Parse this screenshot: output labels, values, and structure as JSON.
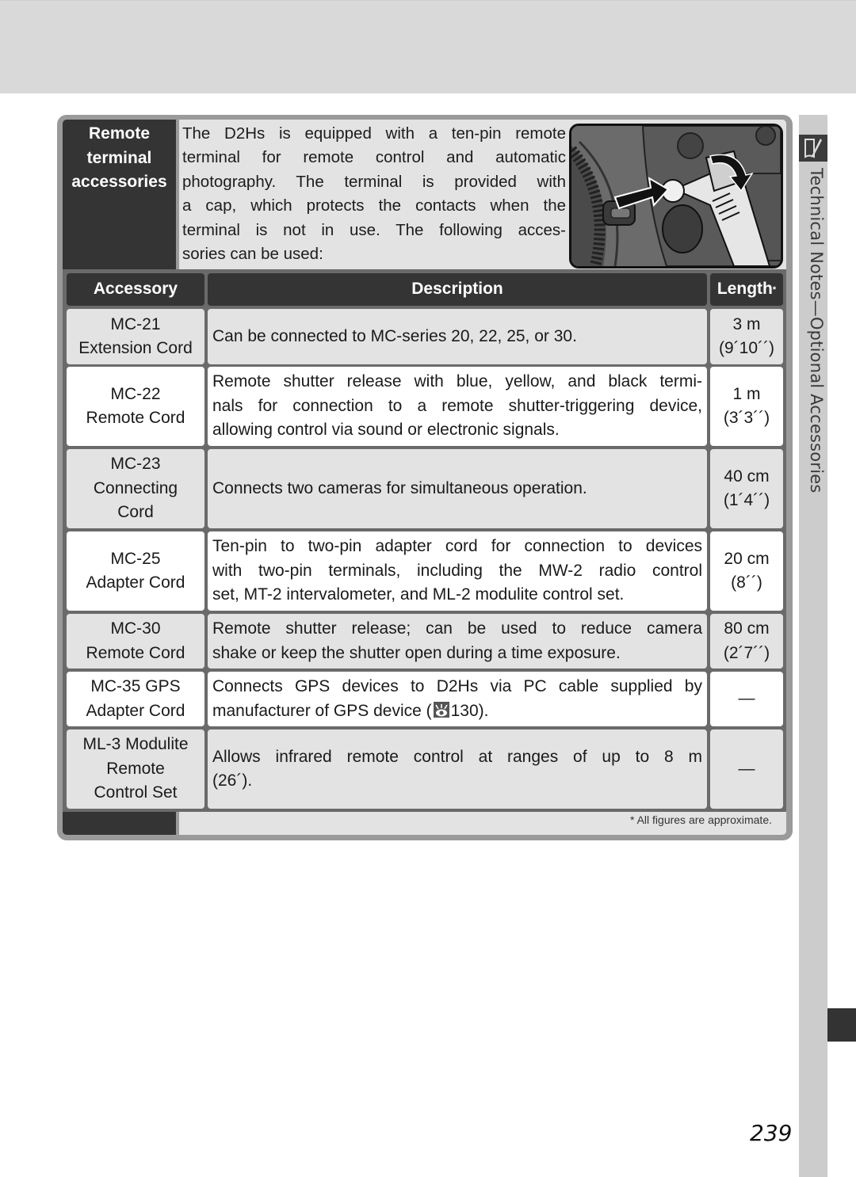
{
  "section": {
    "title_lines": [
      "Remote",
      "terminal",
      "accessories"
    ],
    "intro_lines": [
      "The D2Hs is equipped with a ten-pin remote",
      "terminal for remote control and automatic",
      "photography.  The terminal is provided with",
      "a cap, which protects the contacts when the",
      "terminal is not in use.  The following acces-",
      "sories can be used:"
    ],
    "figure_icon": "camera-remote-terminal-illustration"
  },
  "table": {
    "headers": {
      "accessory": "Accessory",
      "description": "Description",
      "length": "Length",
      "length_marker": "*"
    },
    "rows": [
      {
        "accessory_lines": [
          "MC-21",
          "Extension Cord"
        ],
        "description_lines": [
          "Can be connected to MC-series 20, 22, 25, or 30."
        ],
        "length_lines": [
          "3 m",
          "(9´10´´)"
        ]
      },
      {
        "accessory_lines": [
          "MC-22",
          "Remote Cord"
        ],
        "description_lines": [
          "Remote shutter release with blue, yellow, and black termi-",
          "nals for connection to a remote shutter-triggering device,",
          "allowing control via sound or electronic signals."
        ],
        "length_lines": [
          "1 m",
          "(3´3´´)"
        ]
      },
      {
        "accessory_lines": [
          "MC-23",
          "Connecting",
          "Cord"
        ],
        "description_lines": [
          "Connects two cameras for simultaneous operation."
        ],
        "length_lines": [
          "40 cm",
          "(1´4´´)"
        ]
      },
      {
        "accessory_lines": [
          "MC-25",
          "Adapter Cord"
        ],
        "description_lines": [
          "Ten-pin to two-pin adapter cord for connection to devices",
          "with two-pin terminals, including the MW-2 radio control",
          "set, MT-2 intervalometer, and ML-2 modulite control set."
        ],
        "length_lines": [
          "20 cm",
          "(8´´)"
        ]
      },
      {
        "accessory_lines": [
          "MC-30",
          "Remote Cord"
        ],
        "description_lines": [
          "Remote shutter release; can be used to reduce camera",
          "shake or keep the shutter open during a time exposure."
        ],
        "length_lines": [
          "80 cm",
          "(2´7´´)"
        ]
      },
      {
        "accessory_lines": [
          "MC-35 GPS",
          "Adapter Cord"
        ],
        "description_lines": [
          "Connects GPS devices to D2Hs via PC cable supplied by",
          "manufacturer of GPS device ("
        ],
        "description_ref_icon": "page-reference-eye-icon",
        "description_ref_page": "130).",
        "length_lines": [
          "—"
        ]
      },
      {
        "accessory_lines": [
          "ML-3 Modulite",
          "Remote",
          "Control Set"
        ],
        "description_lines": [
          "Allows infrared remote control at ranges of up to 8 m",
          "(26´)."
        ],
        "length_lines": [
          "—"
        ]
      }
    ],
    "footnote": "*   All figures are approximate."
  },
  "side_tab": {
    "icon": "technical-notes-pen-icon",
    "label": "Technical Notes—Optional Accessories"
  },
  "page_number": "239"
}
